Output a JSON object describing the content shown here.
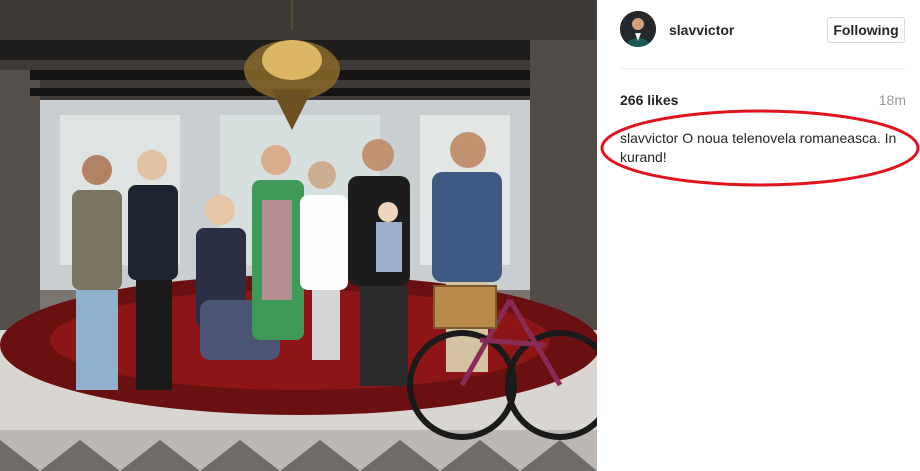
{
  "post": {
    "username": "slavvictor",
    "follow_label": "Following",
    "likes": "266 likes",
    "time": "18m",
    "caption_author": "slavvictor",
    "caption_text": "O noua telenovela romaneasca. In kurand!"
  },
  "colors": {
    "annotation_ellipse": "#e0141e",
    "text": "#262626",
    "muted": "#999999"
  },
  "icons": {
    "avatar": "profile-photo"
  }
}
